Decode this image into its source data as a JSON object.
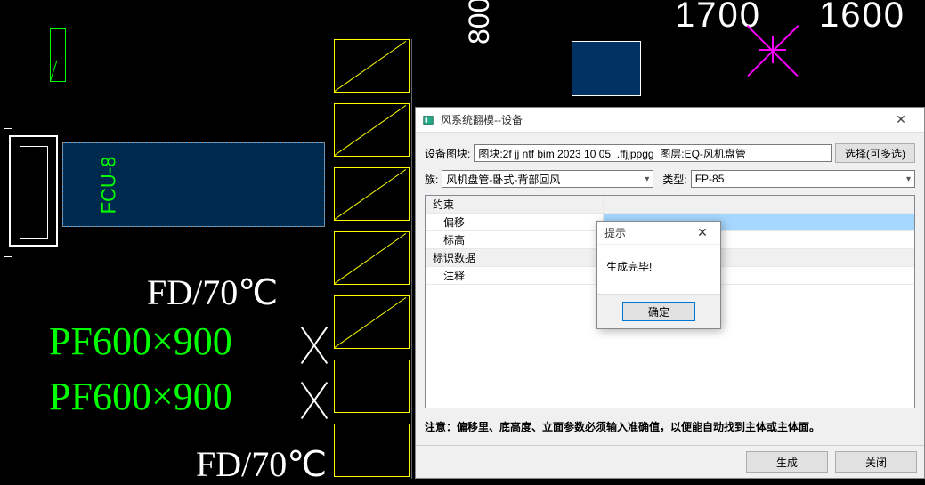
{
  "cad": {
    "fcu_label": "FCU-8",
    "fd_text_1": "FD/70℃",
    "pf_text_1": "PF600×900",
    "pf_text_2": "PF600×900",
    "fd_text_2": "FD/70℃",
    "top_number_1": "1700",
    "top_number_2": "1600",
    "vert_text": "800"
  },
  "dialog": {
    "title": "风系统翻模--设备",
    "block_label": "设备图块:",
    "block_value": "图块:2f jj ntf bim 2023 10 05  .ffjjppgg  图层:EQ-风机盘管",
    "select_btn": "选择(可多选)",
    "family_label": "族:",
    "family_value": " 风机盘管-卧式-背部回风",
    "type_label": "类型:",
    "type_value": "FP-85",
    "grid": {
      "section1": "约束",
      "offset_label": "偏移",
      "offset_value": "",
      "level_label": "标高",
      "level_value": "",
      "section2": "标识数据",
      "comment_label": "注释",
      "comment_value": ""
    },
    "notice_prefix": "注意：",
    "notice_text": "偏移里、底高度、立面参数必须输入准确值，以便能自动找到主体或主体面。",
    "generate_btn": "生成",
    "close_btn": "关闭"
  },
  "msgbox": {
    "title": "提示",
    "message": "生成完毕!",
    "ok_btn": "确定"
  }
}
